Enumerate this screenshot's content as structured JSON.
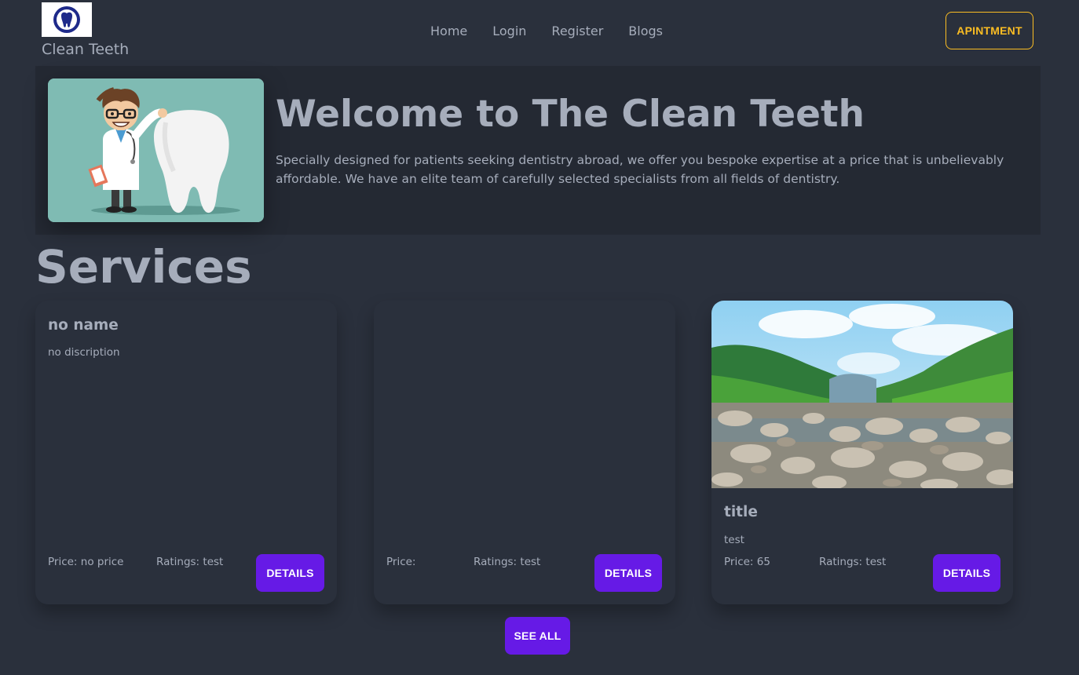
{
  "navbar": {
    "brand": "Clean Teeth",
    "links": [
      "Home",
      "Login",
      "Register",
      "Blogs"
    ],
    "appointment_label": "APINTMENT",
    "accent_color": "#fbbd23",
    "logo_icon": "tooth-icon"
  },
  "hero": {
    "title": "Welcome to The Clean Teeth",
    "text": "Specially designed for patients seeking dentistry abroad, we offer you bespoke expertise at a price that is unbelievably affordable. We have an elite team of carefully selected specialists from all fields of dentistry.",
    "image": "dentist-with-tooth-illustration"
  },
  "services": {
    "heading": "Services",
    "cards": [
      {
        "title": "no name",
        "description": "no discription",
        "price": "Price: no price",
        "ratings": "Ratings: test",
        "button": "DETAILS"
      },
      {
        "title": "",
        "description": "",
        "price": "Price:",
        "ratings": "Ratings: test",
        "button": "DETAILS"
      },
      {
        "title": "title",
        "description": "test",
        "price": "Price: 65",
        "ratings": "Ratings: test",
        "button": "DETAILS",
        "image": "mountain-river-photo"
      }
    ],
    "see_all": "SEE ALL",
    "primary_color": "#661ae6"
  }
}
